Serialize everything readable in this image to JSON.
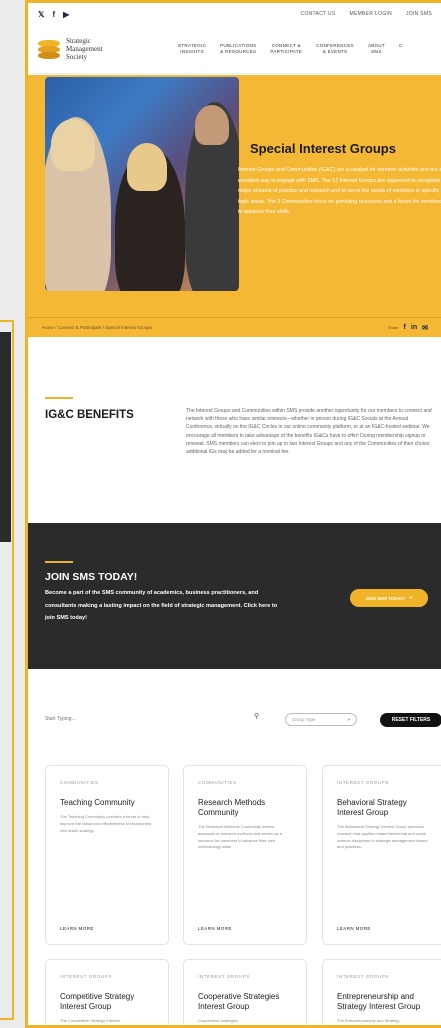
{
  "top": {
    "social": [
      "twitter-icon",
      "facebook-icon",
      "youtube-icon"
    ],
    "links": [
      "CONTACT US",
      "MEMBER LOGIN",
      "JOIN SMS"
    ]
  },
  "logo": {
    "line1": "Strategic",
    "line2": "Management",
    "line3": "Society"
  },
  "nav": [
    {
      "l1": "STRATEGIC",
      "l2": "INSIGHTS"
    },
    {
      "l1": "PUBLICATIONS",
      "l2": "& RESOURCES"
    },
    {
      "l1": "CONNECT &",
      "l2": "PARTICIPATE"
    },
    {
      "l1": "CONFERENCES",
      "l2": "& EVENTS"
    },
    {
      "l1": "ABOUT",
      "l2": "SMS"
    },
    {
      "l1": "C",
      "l2": ""
    }
  ],
  "hero": {
    "title": "Special Interest Groups",
    "text": "Interest Groups and Communities (IG&C) are a catalyst for member activities and are an excellent way to engage with SMS. The 12 Interest Groups are organized to recognize major streams of practice and research and to serve the needs of members in specific topic areas. The 3 Communities focus on providing resources and a forum for members to advance their skills.",
    "breadcrumb": "Home / Connect & Participate / Special Interest Groups",
    "share_label": "Share"
  },
  "benefits": {
    "title": "IG&C BENEFITS",
    "text": "The Interest Groups and Communities within SMS provide another opportunity for our members to connect and network with those who have similar interests—whether in person during IG&C Socials at the Annual Conference, virtually on the IG&C Circles in our online community platform, or at an IG&C-hosted webinar. We encourage all members to take advantage of the benefits IG&Cs have to offer! During membership signup or renewal, SMS members can elect to join up to two Interest Groups and any of the Communities of their choice; additional IGs may be added for a nominal fee."
  },
  "join": {
    "title": "JOIN SMS TODAY!",
    "text": "Become a part of the SMS community of academics, business practitioners, and consultants making a lasting impact on the field of strategic management. Click here to join SMS today!",
    "button": "JOIN SMS TODAY!"
  },
  "filters": {
    "search_placeholder": "Start Typing...",
    "group_type": "Group Type",
    "reset": "RESET FILTERS"
  },
  "cards": [
    {
      "cat": "COMMUNITIES",
      "title": "Teaching Community",
      "desc": "The Teaching Community provides a forum to help improve the classroom effectiveness of researchers who teach strategy.",
      "more": "LEARN MORE"
    },
    {
      "cat": "COMMUNITIES",
      "title": "Research Methods Community",
      "desc": "The Research Methods Community fosters advances in research methods and serves as a resource for members to advance their own methodology skills.",
      "more": "LEARN MORE"
    },
    {
      "cat": "INTEREST GROUPS",
      "title": "Behavioral Strategy Interest Group",
      "desc": "The Behavioral Strategy Interest Group sponsors research that applies related behavioral and social science disciplines to strategic management theory and practices.",
      "more": "LEARN MORE"
    },
    {
      "cat": "INTEREST GROUPS",
      "title": "Competitive Strategy Interest Group",
      "desc": "The Competitive Strategy Interest",
      "more": ""
    },
    {
      "cat": "INTEREST GROUPS",
      "title": "Cooperative Strategies Interest Group",
      "desc": "Cooperative strategies",
      "more": ""
    },
    {
      "cat": "INTEREST GROUPS",
      "title": "Entrepreneurship and Strategy Interest Group",
      "desc": "The Entrepreneurship and Strategy",
      "more": ""
    }
  ]
}
